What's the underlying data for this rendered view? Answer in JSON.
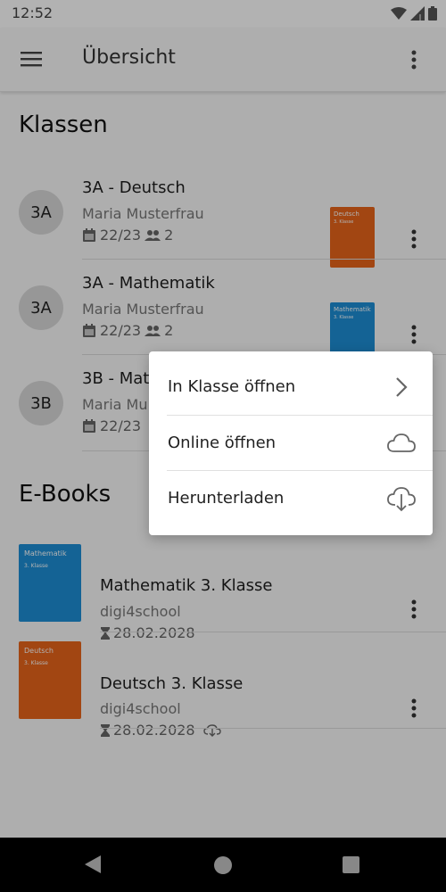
{
  "status": {
    "time": "12:52"
  },
  "app_bar": {
    "title": "Übersicht"
  },
  "classes": {
    "title": "Klassen",
    "items": [
      {
        "avatar": "3A",
        "title": "3A - Deutsch",
        "teacher": "Maria Musterfrau",
        "year": "22/23",
        "students": "2",
        "cover": {
          "color": "#E8651B",
          "title": "Deutsch",
          "sub": "3. Klasse"
        }
      },
      {
        "avatar": "3A",
        "title": "3A - Mathematik",
        "teacher": "Maria Musterfrau",
        "year": "22/23",
        "students": "2",
        "cover": {
          "color": "#1E8FD6",
          "title": "Mathematik",
          "sub": "3. Klasse"
        }
      },
      {
        "avatar": "3B",
        "title": "3B - Mat",
        "teacher": "Maria Mu",
        "year": "22/23"
      }
    ]
  },
  "ebooks": {
    "title": "E-Books",
    "items": [
      {
        "title": "Mathematik 3. Klasse",
        "publisher": "digi4school",
        "expires": "28.02.2028",
        "downloaded": false,
        "cover": {
          "color": "#1E8FD6",
          "title": "Mathematik",
          "sub": "3. Klasse"
        }
      },
      {
        "title": "Deutsch 3. Klasse",
        "publisher": "digi4school",
        "expires": "28.02.2028",
        "downloaded": true,
        "cover": {
          "color": "#E8651B",
          "title": "Deutsch",
          "sub": "3. Klasse"
        }
      }
    ]
  },
  "popup_menu": {
    "items": [
      {
        "label": "In Klasse öffnen",
        "icon": "chevron-right-icon"
      },
      {
        "label": "Online öffnen",
        "icon": "cloud-icon"
      },
      {
        "label": "Herunterladen",
        "icon": "cloud-download-icon"
      }
    ]
  },
  "colors": {
    "scrim": "rgba(0,0,0,0.30)",
    "avatar_bg": "#d9d9d9",
    "cover_orange": "#E8651B",
    "cover_blue": "#1E8FD6"
  }
}
